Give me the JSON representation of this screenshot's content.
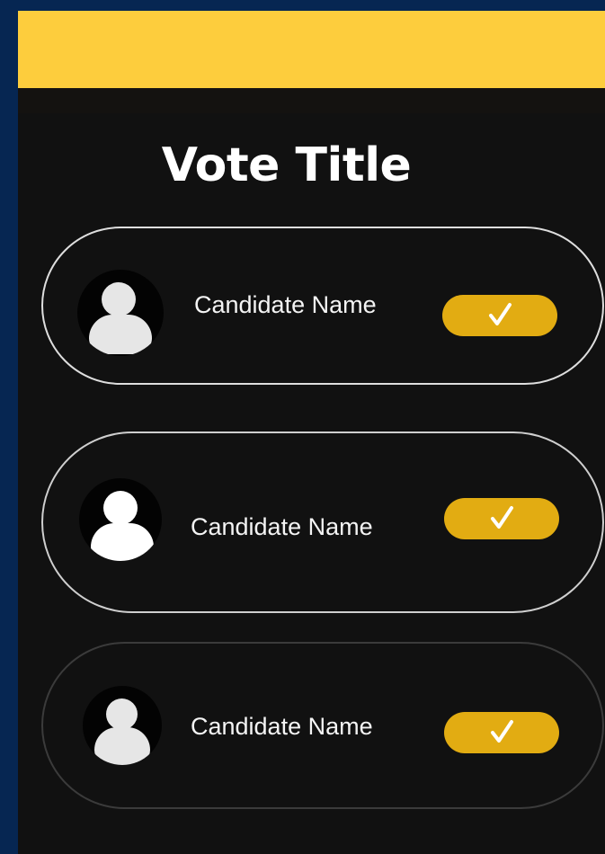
{
  "page": {
    "title": "Vote Title",
    "background_color": "#062652",
    "top_bar_color": "#fdcd3d",
    "panel_color": "#111111",
    "accent_color": "#e2ac12"
  },
  "candidates": [
    {
      "name": "Candidate Name",
      "avatar_icon": "user-silhouette-icon",
      "action_icon": "checkmark-icon"
    },
    {
      "name": "Candidate Name",
      "avatar_icon": "user-silhouette-icon",
      "action_icon": "checkmark-icon"
    },
    {
      "name": "Candidate Name",
      "avatar_icon": "user-silhouette-icon",
      "action_icon": "checkmark-icon"
    }
  ]
}
